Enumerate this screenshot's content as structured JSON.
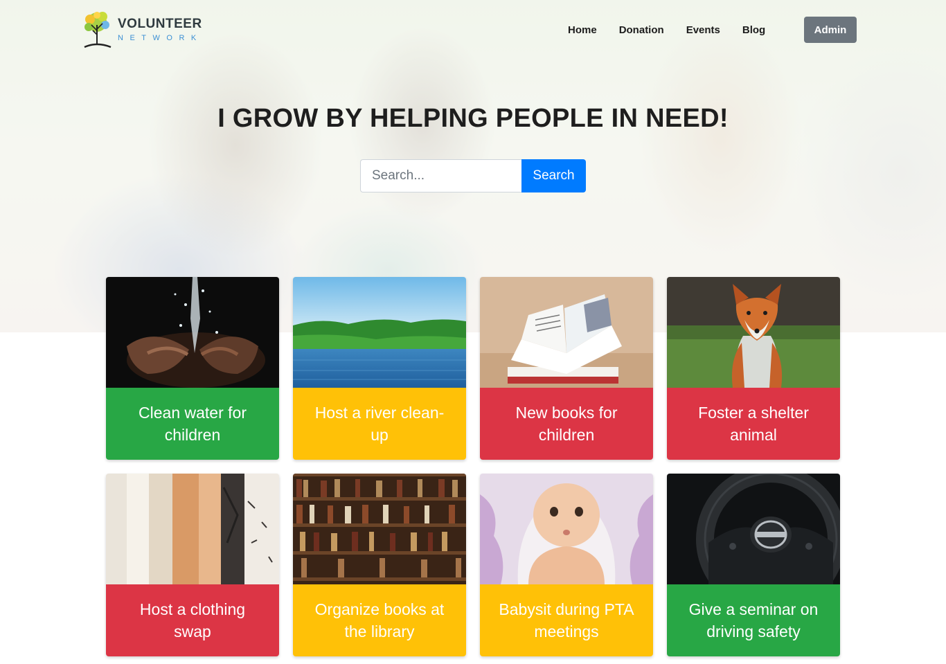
{
  "brand": {
    "title": "VOLUNTEER",
    "subtitle": "NETWORK"
  },
  "nav": {
    "items": [
      {
        "label": "Home"
      },
      {
        "label": "Donation"
      },
      {
        "label": "Events"
      },
      {
        "label": "Blog"
      }
    ],
    "admin_label": "Admin"
  },
  "hero": {
    "headline": "I GROW BY HELPING PEOPLE IN NEED!",
    "search": {
      "placeholder": "Search...",
      "value": "",
      "button_label": "Search"
    }
  },
  "events": [
    {
      "title": "Clean water for children",
      "color": "#28a745",
      "image": "water-hands-photo"
    },
    {
      "title": "Host a river clean-up",
      "color": "#ffc107",
      "image": "river-photo"
    },
    {
      "title": "New books for children",
      "color": "#dc3545",
      "image": "open-book-photo"
    },
    {
      "title": "Foster a shelter animal",
      "color": "#dc3545",
      "image": "fox-photo"
    },
    {
      "title": "Host a clothing swap",
      "color": "#dc3545",
      "image": "clothing-rack-photo"
    },
    {
      "title": "Organize books at the library",
      "color": "#ffc107",
      "image": "bookshelf-photo"
    },
    {
      "title": "Babysit during PTA meetings",
      "color": "#ffc107",
      "image": "baby-photo"
    },
    {
      "title": "Give a seminar on driving safety",
      "color": "#28a745",
      "image": "steering-wheel-photo"
    }
  ]
}
